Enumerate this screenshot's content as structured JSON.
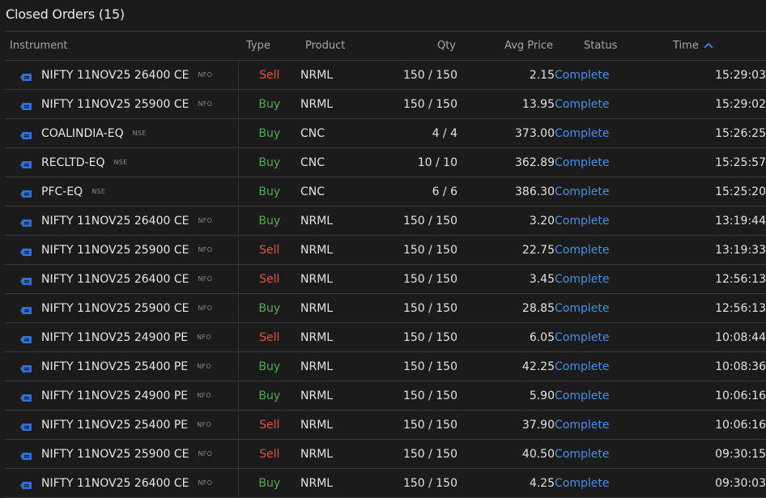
{
  "header": {
    "title": "Closed Orders (15)"
  },
  "columns": {
    "instrument": "Instrument",
    "type": "Type",
    "product": "Product",
    "qty": "Qty",
    "avg_price": "Avg Price",
    "status": "Status",
    "time": "Time"
  },
  "colors": {
    "background": "#1b1b1b",
    "buy": "#4caf50",
    "sell": "#e5533d",
    "status_link": "#4a8fe7",
    "instrument_icon": "#2f6fd6"
  },
  "icons": {
    "instrument": "order-tag-icon",
    "sort": "chevron-up-icon"
  },
  "orders": [
    {
      "instrument": "NIFTY 11NOV25 26400 CE",
      "exchange": "NFO",
      "type": "Sell",
      "product": "NRML",
      "qty": "150 / 150",
      "avg_price": "2.15",
      "status": "Complete",
      "time": "15:29:03"
    },
    {
      "instrument": "NIFTY 11NOV25 25900 CE",
      "exchange": "NFO",
      "type": "Buy",
      "product": "NRML",
      "qty": "150 / 150",
      "avg_price": "13.95",
      "status": "Complete",
      "time": "15:29:02"
    },
    {
      "instrument": "COALINDIA-EQ",
      "exchange": "NSE",
      "type": "Buy",
      "product": "CNC",
      "qty": "4 / 4",
      "avg_price": "373.00",
      "status": "Complete",
      "time": "15:26:25"
    },
    {
      "instrument": "RECLTD-EQ",
      "exchange": "NSE",
      "type": "Buy",
      "product": "CNC",
      "qty": "10 / 10",
      "avg_price": "362.89",
      "status": "Complete",
      "time": "15:25:57"
    },
    {
      "instrument": "PFC-EQ",
      "exchange": "NSE",
      "type": "Buy",
      "product": "CNC",
      "qty": "6 / 6",
      "avg_price": "386.30",
      "status": "Complete",
      "time": "15:25:20"
    },
    {
      "instrument": "NIFTY 11NOV25 26400 CE",
      "exchange": "NFO",
      "type": "Buy",
      "product": "NRML",
      "qty": "150 / 150",
      "avg_price": "3.20",
      "status": "Complete",
      "time": "13:19:44"
    },
    {
      "instrument": "NIFTY 11NOV25 25900 CE",
      "exchange": "NFO",
      "type": "Sell",
      "product": "NRML",
      "qty": "150 / 150",
      "avg_price": "22.75",
      "status": "Complete",
      "time": "13:19:33"
    },
    {
      "instrument": "NIFTY 11NOV25 26400 CE",
      "exchange": "NFO",
      "type": "Sell",
      "product": "NRML",
      "qty": "150 / 150",
      "avg_price": "3.45",
      "status": "Complete",
      "time": "12:56:13"
    },
    {
      "instrument": "NIFTY 11NOV25 25900 CE",
      "exchange": "NFO",
      "type": "Buy",
      "product": "NRML",
      "qty": "150 / 150",
      "avg_price": "28.85",
      "status": "Complete",
      "time": "12:56:13"
    },
    {
      "instrument": "NIFTY 11NOV25 24900 PE",
      "exchange": "NFO",
      "type": "Sell",
      "product": "NRML",
      "qty": "150 / 150",
      "avg_price": "6.05",
      "status": "Complete",
      "time": "10:08:44"
    },
    {
      "instrument": "NIFTY 11NOV25 25400 PE",
      "exchange": "NFO",
      "type": "Buy",
      "product": "NRML",
      "qty": "150 / 150",
      "avg_price": "42.25",
      "status": "Complete",
      "time": "10:08:36"
    },
    {
      "instrument": "NIFTY 11NOV25 24900 PE",
      "exchange": "NFO",
      "type": "Buy",
      "product": "NRML",
      "qty": "150 / 150",
      "avg_price": "5.90",
      "status": "Complete",
      "time": "10:06:16"
    },
    {
      "instrument": "NIFTY 11NOV25 25400 PE",
      "exchange": "NFO",
      "type": "Sell",
      "product": "NRML",
      "qty": "150 / 150",
      "avg_price": "37.90",
      "status": "Complete",
      "time": "10:06:16"
    },
    {
      "instrument": "NIFTY 11NOV25 25900 CE",
      "exchange": "NFO",
      "type": "Sell",
      "product": "NRML",
      "qty": "150 / 150",
      "avg_price": "40.50",
      "status": "Complete",
      "time": "09:30:15"
    },
    {
      "instrument": "NIFTY 11NOV25 26400 CE",
      "exchange": "NFO",
      "type": "Buy",
      "product": "NRML",
      "qty": "150 / 150",
      "avg_price": "4.25",
      "status": "Complete",
      "time": "09:30:03"
    }
  ]
}
